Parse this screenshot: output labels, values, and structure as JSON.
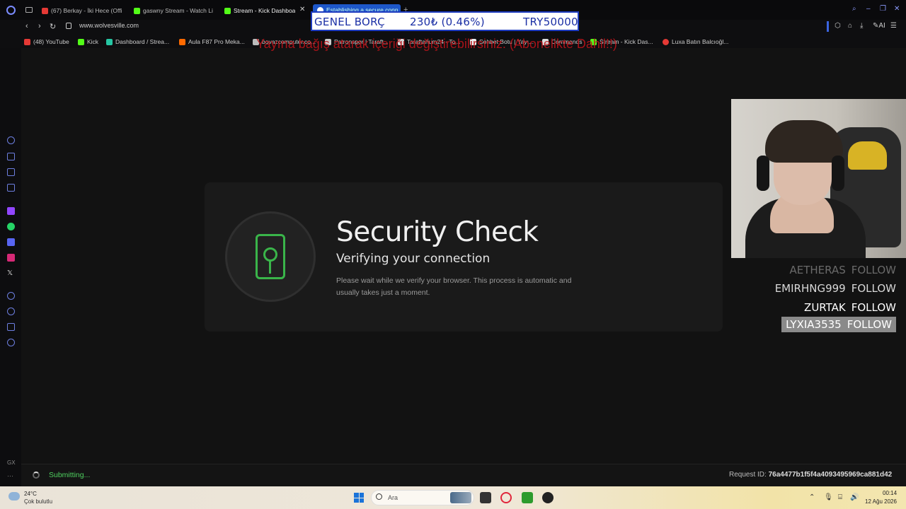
{
  "tabs": [
    {
      "label": "(67) Berkay - İki Hece (Offi",
      "color": "#e53935"
    },
    {
      "label": "gaswny Stream - Watch Li",
      "color": "#53fc18"
    },
    {
      "label": "Stream - Kick Dashboa",
      "color": "#53fc18"
    },
    {
      "label": "Establishing a secure conn",
      "color": "#ffffff"
    }
  ],
  "overlay": {
    "title": "GENEL BORÇ",
    "change": "230₺ (0.46%)",
    "total": "TRY50000"
  },
  "address": {
    "url": "www.wolvesville.com",
    "ai_label": "AI"
  },
  "bookmarks": [
    {
      "label": "(48) YouTube",
      "color": "#e53935"
    },
    {
      "label": "Kick",
      "color": "#53fc18"
    },
    {
      "label": "Dashboard / Strea...",
      "color": "#26c6a3"
    },
    {
      "label": "Aula F87 Pro Meka...",
      "color": "#ff6a00"
    },
    {
      "label": "bovazcomputer.co...",
      "color": "#bbbbbb"
    },
    {
      "label": "Patronspor | Taraft...",
      "color": "#cccccc"
    },
    {
      "label": "Taraftarium24 - To...",
      "color": "#d8d8d8"
    },
    {
      "label": "Sohbet Botu | Yayı...",
      "color": "#eeeeee"
    },
    {
      "label": "Commands",
      "color": "#dddddd"
    },
    {
      "label": "Stream - Kick Das...",
      "color": "#53fc18"
    },
    {
      "label": "Luxa Batın Balcıoğl...",
      "color": "#e53935"
    }
  ],
  "donate_text": "Yayına bağış atarak içeriği değiştirebilirsiniz. (Abonelikte Dahil!!)",
  "security": {
    "title": "Security Check",
    "subtitle": "Verifying your connection",
    "description": "Please wait while we verify your browser. This process is automatic and usually takes just a moment."
  },
  "follows": [
    {
      "name": "AETHERAS",
      "action": "FOLLOW"
    },
    {
      "name": "EMIRHNG999",
      "action": "FOLLOW"
    },
    {
      "name": "ZURTAK",
      "action": "FOLLOW"
    },
    {
      "name": "LYXIA3535",
      "action": "FOLLOW"
    }
  ],
  "status": {
    "text": "Submitting...",
    "request_label": "Request ID:",
    "request_id": "76a4477b1f5f4a4093495969ca881d42"
  },
  "taskbar": {
    "temp": "24°C",
    "weather": "Çok bulutlu",
    "search_placeholder": "Ara",
    "time": "00:14",
    "date": "12 Ağu 2026"
  },
  "sidebar_label": "GX",
  "colors": {
    "accent_green": "#3ab54a",
    "kick_green": "#53fc18",
    "status_green": "#4fd05f",
    "overlay_blue": "#1b2fa5"
  }
}
